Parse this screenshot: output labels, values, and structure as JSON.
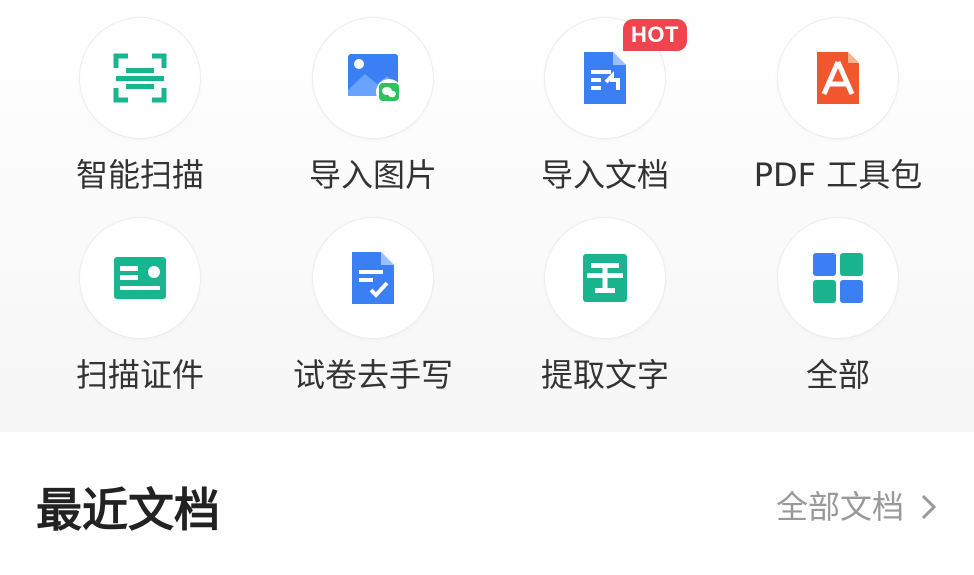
{
  "tools": [
    {
      "label": "智能扫描",
      "icon": "scan-icon"
    },
    {
      "label": "导入图片",
      "icon": "import-image-icon"
    },
    {
      "label": "导入文档",
      "icon": "import-document-icon",
      "badge": "HOT"
    },
    {
      "label": "PDF 工具包",
      "icon": "pdf-icon"
    },
    {
      "label": "扫描证件",
      "icon": "id-card-icon"
    },
    {
      "label": "试卷去手写",
      "icon": "exam-paper-icon"
    },
    {
      "label": "提取文字",
      "icon": "extract-text-icon"
    },
    {
      "label": "全部",
      "icon": "grid-icon"
    }
  ],
  "recent": {
    "title": "最近文档",
    "all_docs_label": "全部文档"
  },
  "colors": {
    "green": "#19b58f",
    "blue": "#3b7ff5",
    "red_orange": "#f1562e",
    "hot_badge": "#f0444f",
    "wechat_green": "#2bc35a"
  }
}
